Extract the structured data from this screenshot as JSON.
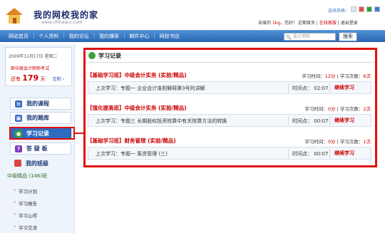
{
  "header": {
    "site_title": "我的网校我的家",
    "site_url": "www.chinaacc.com",
    "style_label": "选择风格：",
    "swatch_colors": [
      "#d8e6f6",
      "#e94c3d",
      "#2e9b3e",
      "#3c7ed6"
    ],
    "greeting_prefix": "亲爱的",
    "username": "1kg",
    "greeting_suffix": "，您好！",
    "recent_label": "近期首页",
    "online_label": "在线客服",
    "logout_label": "退出登录"
  },
  "nav": {
    "items": [
      "网站首页",
      "个人资料",
      "我的论坛",
      "我的播客",
      "邮件中心",
      "网校书店"
    ],
    "search_placeholder": "会计资料",
    "search_button": "搜索"
  },
  "sidebar": {
    "date": "2009年11月17日  星期二",
    "exam_label": "距中级会计职称考试",
    "remain_prefix": "还有",
    "remain_days": "179",
    "remain_unit": "天",
    "set_link": "定制 ›",
    "menu": [
      {
        "label": "我的课程",
        "icon": "book-icon",
        "color": "#3b72c8"
      },
      {
        "label": "我的题库",
        "icon": "question-bank-icon",
        "color": "#3b72c8"
      },
      {
        "label": "学习记录",
        "icon": "record-icon",
        "color": "#3aa03a"
      },
      {
        "label": "答 疑 板",
        "icon": "help-icon",
        "color": "#7c3bc0"
      }
    ],
    "class_head": "我的班级",
    "class_name": "中级精品 (146)班",
    "sub_items": [
      "学习计划",
      "学习报告",
      "学习心得",
      "学习交流"
    ]
  },
  "main": {
    "panel_title": "学习记录",
    "courses": [
      {
        "title": "【基础学习班】中级会计实务 (实验/精品)",
        "time_label": "学习时间：",
        "time_value": "12分",
        "count_label": "学习次数：",
        "count_value": "6次",
        "last_study": "上次学习：专题一   企业会计准则解释第3号的讲解",
        "time_point_label": "时间点：",
        "time_point": "02:07",
        "continue_label": "继续学习"
      },
      {
        "title": "【强化提高班】中级会计实务 (实验/精品)",
        "time_label": "学习时间：",
        "time_value": "0分",
        "count_label": "学习次数：",
        "count_value": "2次",
        "last_study": "上次学习：专题三   长期股权投资核算中有关核算方法的转换",
        "time_point_label": "时间点：",
        "time_point": "00:07",
        "continue_label": "继续学习"
      },
      {
        "title": "【基础学习班】财务管理 (实验/精品)",
        "time_label": "学习时间：",
        "time_value": "0分",
        "count_label": "学习次数：",
        "count_value": "1次",
        "last_study": "上次学习：专题一   筹资管理 (三)",
        "time_point_label": "时间点：",
        "time_point": "00:07",
        "continue_label": "继续学习"
      }
    ]
  },
  "colors": {
    "highlight": "#e01010",
    "nav_blue": "#2a67b4",
    "accent_red": "#cc0000"
  }
}
